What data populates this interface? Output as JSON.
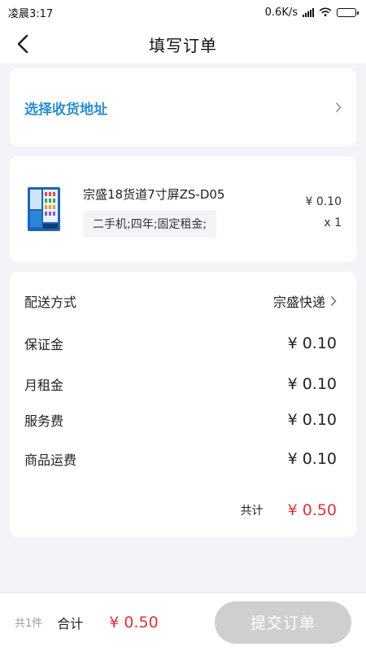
{
  "status_bar": {
    "time": "凌晨3:17",
    "net_speed": "0.6K/s"
  },
  "header": {
    "title": "填写订单",
    "back_icon": "chevron-left-icon"
  },
  "address": {
    "label": "选择收货地址",
    "accent_color": "#2a8ed1"
  },
  "product": {
    "name": "宗盛18货道7寸屏ZS-D05",
    "spec": "二手机;四年;固定租金;",
    "price": "¥ 0.10",
    "quantity": "x 1"
  },
  "fees": {
    "delivery_label": "配送方式",
    "delivery_value": "宗盛快递",
    "deposit_label": "保证金",
    "deposit_value": "¥ 0.10",
    "rent_label": "月租金",
    "rent_value": "¥ 0.10",
    "service_label": "服务费",
    "service_value": "¥ 0.10",
    "shipping_label": "商品运费",
    "shipping_value": "¥ 0.10",
    "total_label": "共计",
    "total_value": "¥ 0.50"
  },
  "footer": {
    "count": "共1件",
    "sum_label": "合计",
    "sum_value": "¥ 0.50",
    "submit_label": "提交订单"
  },
  "colors": {
    "price_red": "#d9343a",
    "button_disabled": "#cfcfcf"
  }
}
